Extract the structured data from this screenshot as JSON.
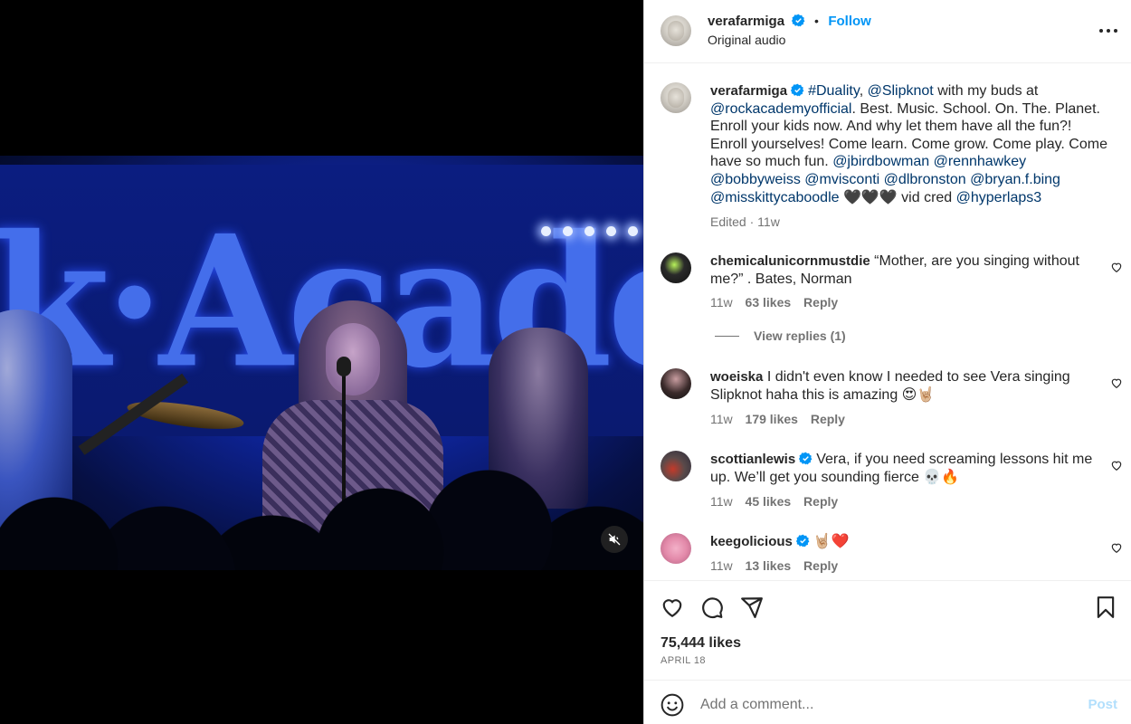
{
  "post": {
    "username": "verafarmiga",
    "follow_label": "Follow",
    "separator": "•",
    "audio": "Original audio"
  },
  "caption": {
    "username": "verafarmiga",
    "segments": [
      {
        "text": "#Duality",
        "link": true
      },
      {
        "text": ", ",
        "link": false
      },
      {
        "text": "@Slipknot",
        "link": true
      },
      {
        "text": " with my buds at ",
        "link": false
      },
      {
        "text": "@rockacademyofficial",
        "link": true
      },
      {
        "text": ". Best. Music. School. On. The. Planet. Enroll your kids now. And why let them have all the fun?! Enroll yourselves! Come learn. Come grow. Come play. Come have so much fun. ",
        "link": false
      },
      {
        "text": "@jbirdbowman",
        "link": true
      },
      {
        "text": " ",
        "link": false
      },
      {
        "text": "@rennhawkey",
        "link": true
      },
      {
        "text": " ",
        "link": false
      },
      {
        "text": "@bobbyweiss",
        "link": true
      },
      {
        "text": " ",
        "link": false
      },
      {
        "text": "@mvisconti",
        "link": true
      },
      {
        "text": " ",
        "link": false
      },
      {
        "text": "@dlbronston",
        "link": true
      },
      {
        "text": " ",
        "link": false
      },
      {
        "text": "@bryan.f.bing",
        "link": true
      },
      {
        "text": " ",
        "link": false
      },
      {
        "text": "@misskittycaboodle",
        "link": true
      },
      {
        "text": " 🖤🖤🖤 vid cred ",
        "link": false
      },
      {
        "text": "@hyperlaps3",
        "link": true
      }
    ],
    "edited": "Edited",
    "time": "11w"
  },
  "comments": [
    {
      "username": "chemicalunicornmustdie",
      "verified": false,
      "text": "“Mother, are you singing without me?” . Bates, Norman",
      "time": "11w",
      "likes": "63 likes",
      "reply": "Reply"
    },
    {
      "username": "woeiska",
      "verified": false,
      "text": "I didn't even know I needed to see Vera singing Slipknot haha this is amazing 😍🤘🏼",
      "time": "11w",
      "likes": "179 likes",
      "reply": "Reply"
    },
    {
      "username": "scottianlewis",
      "verified": true,
      "text": "Vera, if you need screaming lessons hit me up. We’ll get you sounding fierce 💀🔥",
      "time": "11w",
      "likes": "45 likes",
      "reply": "Reply"
    },
    {
      "username": "keegolicious",
      "verified": true,
      "text": "🤘🏼❤️",
      "time": "11w",
      "likes": "13 likes",
      "reply": "Reply"
    }
  ],
  "view_replies": "View replies (1)",
  "likes_total": "75,444 likes",
  "date": "APRIL 18",
  "comment_box": {
    "placeholder": "Add a comment...",
    "post_label": "Post"
  },
  "video": {
    "banner_text": "k·Acade"
  },
  "colors": {
    "accent": "#0095f6",
    "link": "#00376b",
    "verified": "#0095f6",
    "muted": "#737373"
  }
}
